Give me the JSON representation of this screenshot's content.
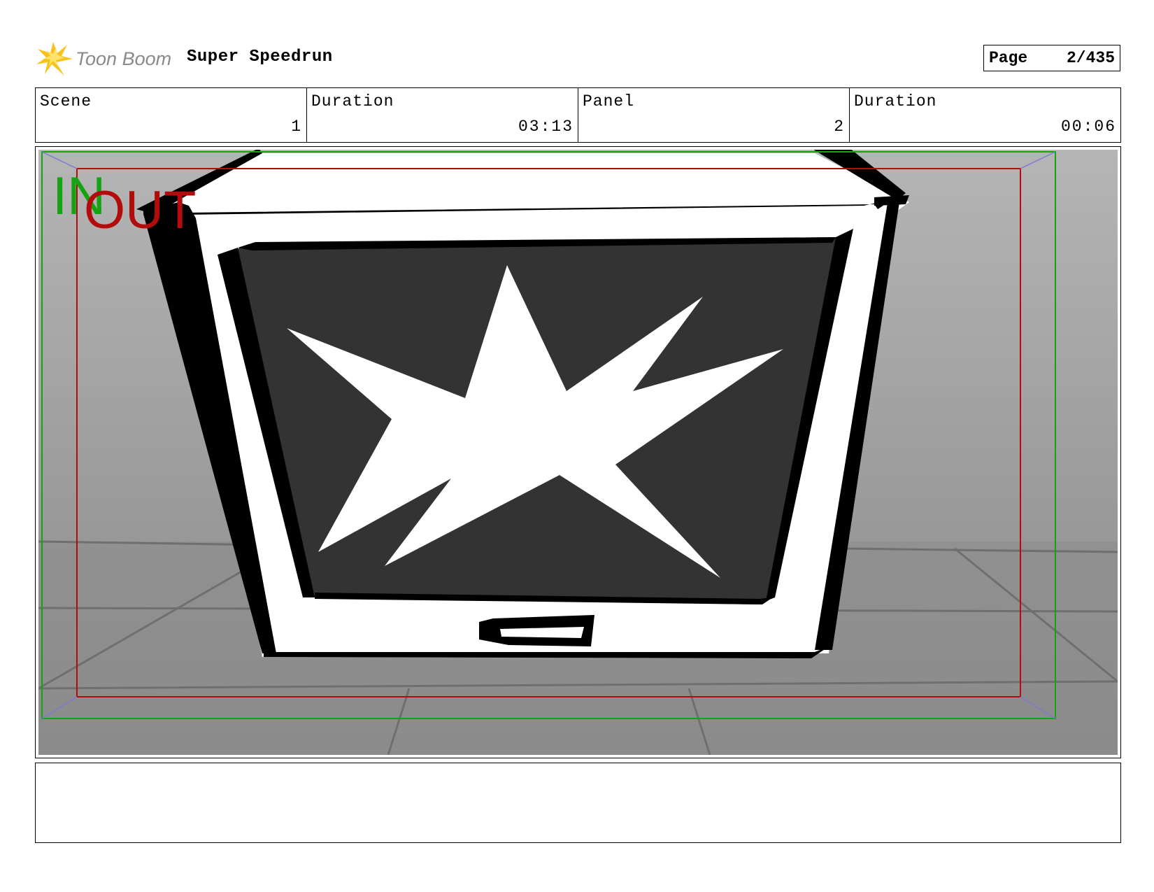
{
  "header": {
    "logo_text": "Toon Boom",
    "project_title": "Super Speedrun",
    "page_label": "Page",
    "page_number": "2/435"
  },
  "info": [
    {
      "label": "Scene",
      "value": "1"
    },
    {
      "label": "Duration",
      "value": "03:13"
    },
    {
      "label": "Panel",
      "value": "2"
    },
    {
      "label": "Duration",
      "value": "00:06"
    }
  ],
  "panel": {
    "field_in_label": "IN",
    "field_out_label": "OUT",
    "colors": {
      "field_in": "#13a313",
      "field_out": "#b30c0c",
      "screen": "#333333",
      "background_top": "#b5b5b5",
      "background_bottom": "#8a8a8a"
    }
  },
  "notes": {
    "text": ""
  }
}
